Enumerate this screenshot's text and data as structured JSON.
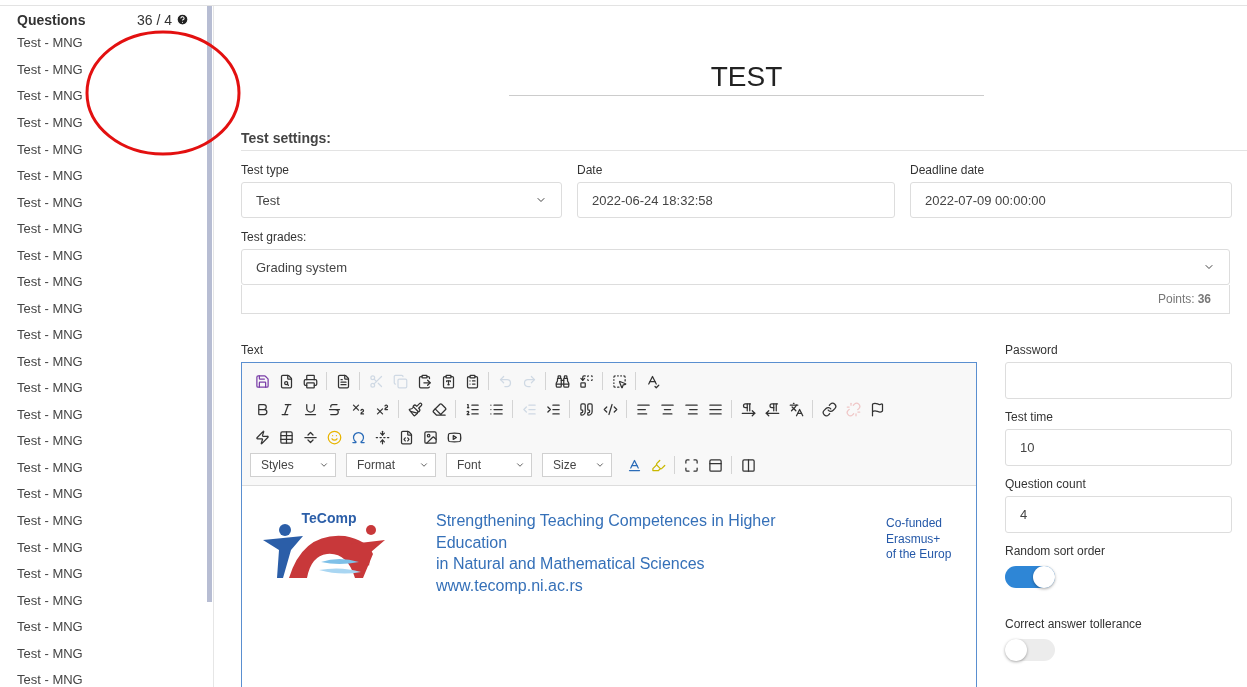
{
  "sidebar": {
    "title": "Questions",
    "count": "36 / 4",
    "items": [
      "Test - MNG",
      "Test - MNG",
      "Test - MNG",
      "Test - MNG",
      "Test - MNG",
      "Test - MNG",
      "Test - MNG",
      "Test - MNG",
      "Test - MNG",
      "Test - MNG",
      "Test - MNG",
      "Test - MNG",
      "Test - MNG",
      "Test - MNG",
      "Test - MNG",
      "Test - MNG",
      "Test - MNG",
      "Test - MNG",
      "Test - MNG",
      "Test - MNG",
      "Test - MNG",
      "Test - MNG",
      "Test - MNG",
      "Test - MNG",
      "Test - MNG"
    ]
  },
  "annotation": {
    "kind": "ellipse"
  },
  "title": "TEST",
  "settings_heading": "Test settings:",
  "fields": [
    {
      "label": "Test type",
      "kind": "select",
      "value": "Test"
    },
    {
      "label": "Date",
      "kind": "input",
      "value": "2022-06-24 18:32:58"
    },
    {
      "label": "Deadline date",
      "kind": "input",
      "value": "2022-07-09 00:00:00"
    }
  ],
  "grades": {
    "label": "Test grades:",
    "value": "Grading system",
    "points_label": "Points:",
    "points": "36"
  },
  "editor": {
    "label": "Text",
    "rows": [
      {
        "groups": [
          {
            "buttons": [
              {
                "disabled": false
              },
              {
                "disabled": false
              },
              {
                "disabled": false
              }
            ]
          },
          {
            "buttons": [
              {
                "disabled": false
              }
            ]
          },
          {
            "buttons": [
              {
                "disabled": true
              },
              {
                "disabled": true
              },
              {
                "disabled": false
              },
              {
                "disabled": false
              },
              {
                "disabled": false
              }
            ]
          },
          {
            "buttons": [
              {
                "disabled": true
              },
              {
                "disabled": true
              }
            ]
          },
          {
            "buttons": [
              {
                "disabled": false
              },
              {
                "disabled": false
              }
            ]
          },
          {
            "buttons": [
              {
                "disabled": false
              }
            ]
          },
          {
            "buttons": [
              {
                "disabled": false
              }
            ]
          }
        ]
      },
      {
        "groups": [
          {
            "buttons": [
              {
                "disabled": false
              },
              {
                "disabled": false
              },
              {
                "disabled": false
              },
              {
                "disabled": false
              },
              {
                "disabled": false
              },
              {
                "disabled": false
              }
            ]
          },
          {
            "buttons": [
              {
                "disabled": false
              },
              {
                "disabled": false
              }
            ]
          },
          {
            "buttons": [
              {
                "disabled": false
              },
              {
                "disabled": false
              }
            ]
          },
          {
            "buttons": [
              {
                "disabled": true
              },
              {
                "disabled": false
              }
            ]
          },
          {
            "buttons": [
              {
                "disabled": false
              },
              {
                "disabled": false
              }
            ]
          },
          {
            "buttons": [
              {
                "disabled": false
              },
              {
                "disabled": false
              },
              {
                "disabled": false
              },
              {
                "disabled": false
              }
            ]
          },
          {
            "buttons": [
              {
                "disabled": false
              },
              {
                "disabled": false
              },
              {
                "disabled": false
              }
            ]
          },
          {
            "buttons": [
              {
                "disabled": false
              },
              {
                "disabled": true
              },
              {
                "disabled": false
              }
            ]
          }
        ]
      },
      {
        "groups": [
          {
            "buttons": [
              {
                "disabled": false
              },
              {
                "disabled": false
              },
              {
                "disabled": false
              },
              {
                "disabled": false
              },
              {
                "disabled": false
              },
              {
                "disabled": false
              },
              {
                "disabled": false
              },
              {
                "disabled": false
              },
              {
                "disabled": false
              }
            ]
          }
        ]
      }
    ],
    "combos": [
      "Styles",
      "Format",
      "Font",
      "Size"
    ],
    "tail_groups": [
      {
        "buttons": [
          {
            "disabled": false
          },
          {
            "disabled": false
          }
        ]
      },
      {
        "buttons": [
          {
            "disabled": false
          },
          {
            "disabled": false
          }
        ]
      },
      {
        "buttons": [
          {
            "disabled": false
          }
        ]
      }
    ],
    "content": {
      "logo_text": "TeComp",
      "lines": [
        "Strengthening Teaching Competences in Higher Education",
        "in Natural and Mathematical Sciences",
        "www.tecomp.ni.ac.rs"
      ],
      "side_lines": [
        "Co-funded",
        "Erasmus+",
        "of the Europ"
      ]
    }
  },
  "side_fields": [
    {
      "label": "Password",
      "kind": "input"
    },
    {
      "label": "Test time",
      "kind": "input",
      "value": "10"
    },
    {
      "label": "Question count",
      "kind": "input",
      "value": "4"
    },
    {
      "label": "Random sort order",
      "kind": "toggle",
      "on": true
    },
    {
      "label": "Correct answer tollerance",
      "kind": "toggle",
      "on": false
    }
  ]
}
